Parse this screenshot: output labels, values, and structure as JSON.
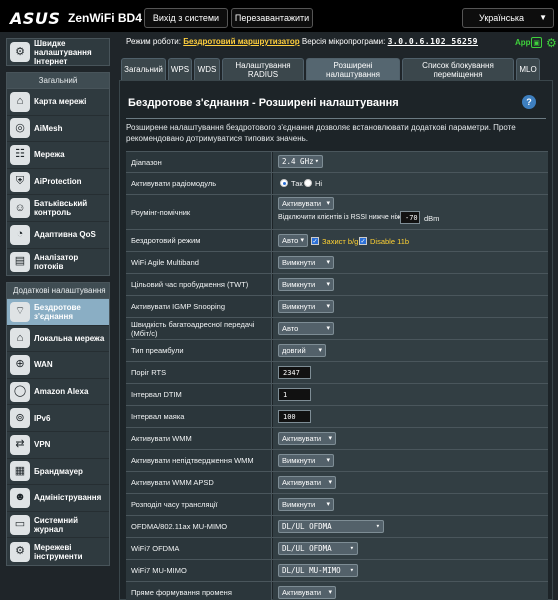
{
  "header": {
    "brand": "ASUS",
    "model": "ZenWiFi BD4",
    "logout_label": "Вихід з системи",
    "reboot_label": "Перезавантажити",
    "language": "Українська"
  },
  "sidebar": {
    "quick_setup": "Швидке налаштування Інтернет",
    "general_title": "Загальний",
    "general_items": [
      {
        "label": "Карта мережі",
        "icon": "network-map-icon"
      },
      {
        "label": "AiMesh",
        "icon": "aimesh-icon"
      },
      {
        "label": "Мережа",
        "icon": "network-icon"
      },
      {
        "label": "AiProtection",
        "icon": "aiprotection-icon"
      },
      {
        "label": "Батьківський контроль",
        "icon": "parental-control-icon"
      },
      {
        "label": "Адаптивна QoS",
        "icon": "qos-icon"
      },
      {
        "label": "Аналізатор потоків",
        "icon": "traffic-analyzer-icon"
      }
    ],
    "advanced_title": "Додаткові налаштування",
    "advanced_items": [
      {
        "label": "Бездротове з'єднання",
        "icon": "wireless-icon"
      },
      {
        "label": "Локальна мережа",
        "icon": "lan-icon"
      },
      {
        "label": "WAN",
        "icon": "wan-icon"
      },
      {
        "label": "Amazon Alexa",
        "icon": "alexa-icon"
      },
      {
        "label": "IPv6",
        "icon": "ipv6-icon"
      },
      {
        "label": "VPN",
        "icon": "vpn-icon"
      },
      {
        "label": "Брандмауер",
        "icon": "firewall-icon"
      },
      {
        "label": "Адміністрування",
        "icon": "administration-icon"
      },
      {
        "label": "Системний журнал",
        "icon": "system-log-icon"
      },
      {
        "label": "Мережеві інструменти",
        "icon": "network-tools-icon"
      }
    ]
  },
  "status": {
    "opmode_prefix": "Режим роботи:",
    "opmode_value": "Бездротовий маршрутизатор",
    "fw_prefix": "Версія мікропрограми:",
    "fw_value": "3.0.0.6.102_56259",
    "app_label": "App"
  },
  "tabs": [
    "Загальний",
    "WPS",
    "WDS",
    "Налаштування RADIUS",
    "Розширені налаштування",
    "Список блокування переміщення",
    "MLO"
  ],
  "panel": {
    "title": "Бездротове з'єднання - Розширені налаштування",
    "description": "Розширене налаштування бездротового з'єднання дозволяє встановлювати додаткові параметри. Проте рекомендовано дотримуватися типових значень."
  },
  "settings": {
    "band": {
      "label": "Діапазон",
      "value": "2.4 GHz"
    },
    "radio": {
      "label": "Активувати радіомодуль",
      "yes": "Так",
      "no": "Ні"
    },
    "roaming": {
      "label": "Роумінг-помічник",
      "value": "Активувати",
      "rssi_text": "Відключити клієнтів із RSSI нижче ніж :",
      "rssi_value": "-70",
      "unit": "dBm"
    },
    "wireless_mode": {
      "label": "Бездротовий режим",
      "value": "Авто",
      "protect_label": "Захист b/g",
      "disable_label": "Disable 11b"
    },
    "agile": {
      "label": "WiFi Agile Multiband",
      "value": "Вимкнути"
    },
    "twt": {
      "label": "Цільовий час пробудження (TWT)",
      "value": "Вимкнути"
    },
    "igmp": {
      "label": "Активувати IGMP Snooping",
      "value": "Вимкнути"
    },
    "multicast": {
      "label": "Швидкість багатоадресної передачі (Мбіт/с)",
      "value": "Авто"
    },
    "preamble": {
      "label": "Тип преамбули",
      "value": "довгий"
    },
    "rts": {
      "label": "Поріг RTS",
      "value": "2347"
    },
    "dtim": {
      "label": "Інтервал DTIM",
      "value": "1"
    },
    "beacon": {
      "label": "Інтервал маяка",
      "value": "100"
    },
    "wmm": {
      "label": "Активувати WMM",
      "value": "Активувати"
    },
    "wmm_noack": {
      "label": "Активувати непідтвердження WMM",
      "value": "Вимкнути"
    },
    "wmm_apsd": {
      "label": "Активувати WMM APSD",
      "value": "Активувати"
    },
    "airtime": {
      "label": "Розподіл часу трансляції",
      "value": "Вимкнути"
    },
    "ofdma": {
      "label": "OFDMA/802.11ax MU-MIMO",
      "value": "DL/UL OFDMA"
    },
    "wifi7_ofdma": {
      "label": "WiFi7 OFDMA",
      "value": "DL/UL OFDMA"
    },
    "wifi7_mumimo": {
      "label": "WiFi7 MU-MIMO",
      "value": "DL/UL MU-MIMO"
    },
    "beamforming": {
      "label": "Пряме формування променя",
      "value": "Активувати"
    }
  }
}
